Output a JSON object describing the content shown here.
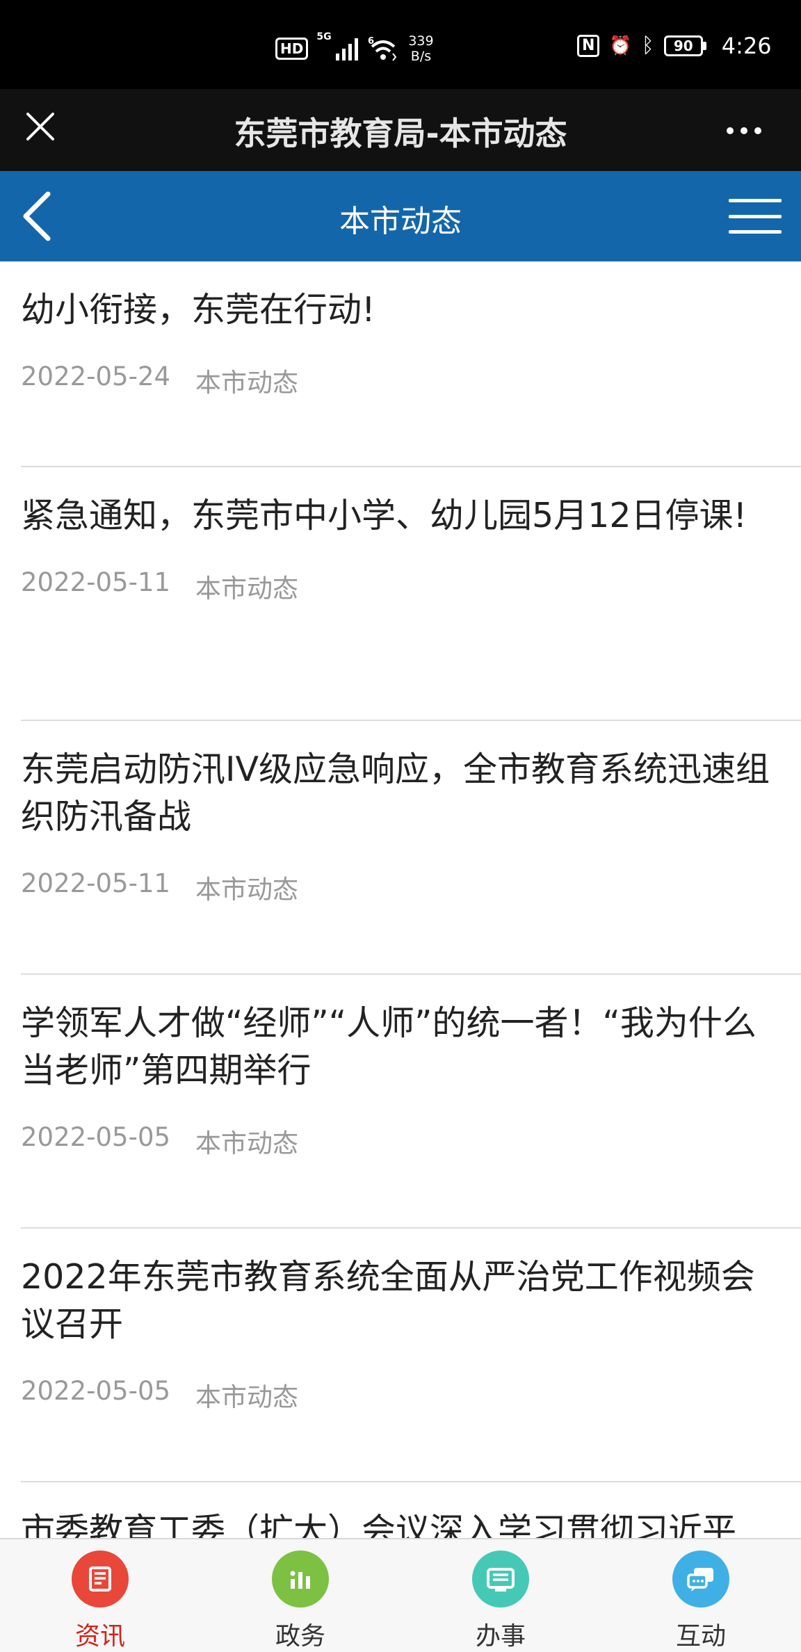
{
  "status_bar": {
    "hd": "HD",
    "signal_gen_1": "5G",
    "signal_gen_2": "6",
    "speed_value": "339",
    "speed_unit": "B/s",
    "nfc_glyph": "N",
    "alarm_glyph": "⏰",
    "bluetooth_glyph": "ᛒ",
    "battery": "90",
    "time": "4:26"
  },
  "window": {
    "title": "东莞市教育局-本市动态"
  },
  "nav": {
    "title": "本市动态"
  },
  "news": [
    {
      "title": "幼小衔接，东莞在行动!",
      "date": "2022-05-24",
      "category": "本市动态"
    },
    {
      "title": "紧急通知，东莞市中小学、幼儿园5月12日停课!",
      "date": "2022-05-11",
      "category": "本市动态"
    },
    {
      "title": "东莞启动防汛IV级应急响应，全市教育系统迅速组织防汛备战",
      "date": "2022-05-11",
      "category": "本市动态"
    },
    {
      "title": "学领军人才做“经师”“人师”的统一者！“我为什么当老师”第四期举行",
      "date": "2022-05-05",
      "category": "本市动态"
    },
    {
      "title": "2022年东莞市教育系统全面从严治党工作视频会议召开",
      "date": "2022-05-05",
      "category": "本市动态"
    },
    {
      "title": "市委教育工委（扩大）会议深入学习贯彻习近平",
      "date": "",
      "category": ""
    }
  ],
  "tabs": [
    {
      "label": "资讯",
      "active": true,
      "color": "#e8473a"
    },
    {
      "label": "政务",
      "active": false,
      "color": "#7cc142"
    },
    {
      "label": "办事",
      "active": false,
      "color": "#45c9b6"
    },
    {
      "label": "互动",
      "active": false,
      "color": "#3fb0e6"
    }
  ]
}
